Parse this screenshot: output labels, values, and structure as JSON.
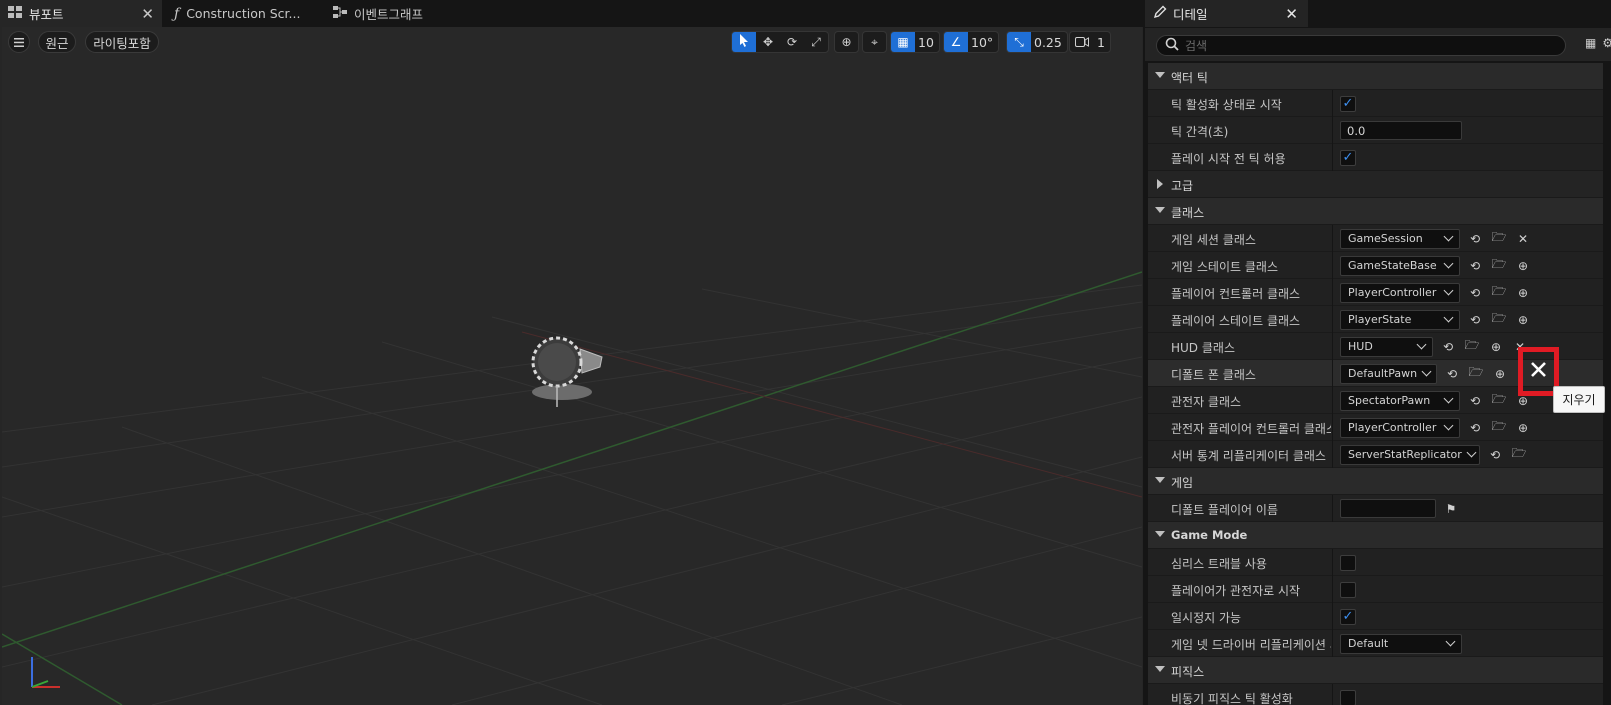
{
  "left_tabs": [
    {
      "label": "뷰포트",
      "icon": "viewport-grid-icon",
      "active": true
    },
    {
      "label": "Construction Scr...",
      "icon": "function-icon",
      "active": false
    },
    {
      "label": "이벤트그래프",
      "icon": "graph-icon",
      "active": false
    }
  ],
  "viewport": {
    "menu_icon": "hamburger-menu-icon",
    "perspective_label": "원근",
    "view_mode_label": "라이팅포함",
    "grid_snap_value": "10",
    "rotation_snap_value": "10°",
    "scale_snap_value": "0.25",
    "camera_speed_value": "1",
    "accent_color": "#1f6fd6"
  },
  "details": {
    "tab_label": "디테일",
    "search_placeholder": "검색",
    "categories": {
      "actor_tick": "액터 틱",
      "advanced": "고급",
      "classes": "클래스",
      "game": "게임",
      "game_mode": "Game Mode",
      "physics": "피직스"
    },
    "actor_tick": {
      "start_with_tick_enabled_label": "틱 활성화 상태로 시작",
      "tick_interval_label": "틱 간격(초)",
      "tick_interval_value": "0.0",
      "tick_before_begin_play_label": "플레이 시작 전 틱 허용"
    },
    "classes": [
      {
        "label": "게임 세션 클래스",
        "value": "GameSession",
        "end_icon": "close-icon"
      },
      {
        "label": "게임 스테이트 클래스",
        "value": "GameStateBase",
        "end_icon": "add-circle-icon"
      },
      {
        "label": "플레이어 컨트롤러 클래스",
        "value": "PlayerController",
        "end_icon": "add-circle-icon"
      },
      {
        "label": "플레이어 스테이트 클래스",
        "value": "PlayerState",
        "end_icon": "add-circle-icon"
      },
      {
        "label": "HUD 클래스",
        "value": "HUD",
        "end_icon": "add-circle-icon"
      },
      {
        "label": "디폴트 폰 클래스",
        "value": "DefaultPawn",
        "end_icon": "add-circle-icon"
      },
      {
        "label": "관전자 클래스",
        "value": "SpectatorPawn",
        "end_icon": "add-circle-icon"
      },
      {
        "label": "관전자 플레이어 컨트롤러 클래스...",
        "value": "PlayerController",
        "end_icon": "add-circle-icon"
      },
      {
        "label": "서버 통계 리플리케이터 클래스",
        "value": "ServerStatReplicator",
        "end_icon": ""
      }
    ],
    "game": {
      "default_player_name_label": "디폴트 플레이어 이름",
      "default_player_name_value": ""
    },
    "game_mode": {
      "seamless_travel_label": "심리스 트래블 사용",
      "start_as_spectator_label": "플레이어가 관전자로 시작",
      "pausable_label": "일시정지 가능",
      "net_driver_label": "게임 넷 드라이버 리플리케이션 시...",
      "net_driver_value": "Default"
    },
    "physics": {
      "async_tick_label": "비동기 피직스 틱 활성화"
    },
    "highlight_color": "#e01b24",
    "tooltip": "지우기"
  }
}
